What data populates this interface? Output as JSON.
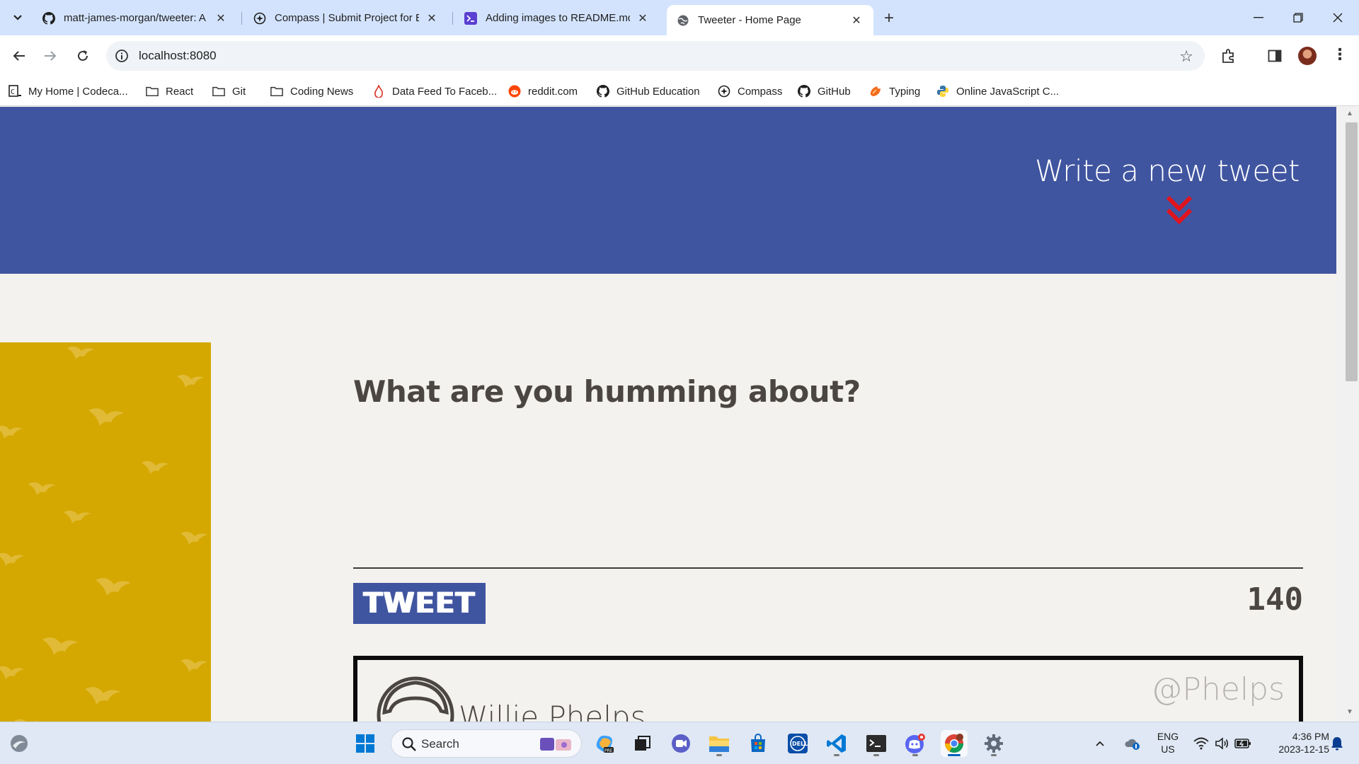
{
  "browser": {
    "tabs": [
      {
        "title": "matt-james-morgan/tweeter: A",
        "icon": "github-icon",
        "active": false
      },
      {
        "title": "Compass | Submit Project for Ev",
        "icon": "compass-icon",
        "active": false
      },
      {
        "title": "Adding images to README.md",
        "icon": "terminal-icon",
        "active": false
      },
      {
        "title": "Tweeter - Home Page",
        "icon": "globe-icon",
        "active": true
      }
    ],
    "address": "localhost:8080",
    "bookmarks": [
      {
        "label": "My Home | Codeca...",
        "icon": "codecademy-icon"
      },
      {
        "label": "React",
        "icon": "folder-icon"
      },
      {
        "label": "Git",
        "icon": "folder-icon"
      },
      {
        "label": "Coding News",
        "icon": "folder-icon"
      },
      {
        "label": "Data Feed To Faceb...",
        "icon": "flame-icon"
      },
      {
        "label": "reddit.com",
        "icon": "reddit-icon"
      },
      {
        "label": "GitHub Education",
        "icon": "github-icon"
      },
      {
        "label": "Compass",
        "icon": "compass-icon"
      },
      {
        "label": "GitHub",
        "icon": "github-icon"
      },
      {
        "label": "Typing",
        "icon": "typing-icon"
      },
      {
        "label": "Online JavaScript C...",
        "icon": "python-icon"
      }
    ]
  },
  "page": {
    "nav": {
      "compose_link": "Write a new tweet"
    },
    "compose": {
      "placeholder": "What are you humming about?",
      "button": "TWEET",
      "counter": "140"
    },
    "tweet": {
      "name": "Willie Phelps",
      "handle": "@Phelps"
    },
    "colors": {
      "header": "#4055a0",
      "sidebar": "#d4a800",
      "background": "#f4f2ef",
      "chevron": "#e0141e"
    }
  },
  "taskbar": {
    "search": "Search",
    "lang": "ENG",
    "region": "US",
    "time": "4:36 PM",
    "date": "2023-12-15"
  }
}
